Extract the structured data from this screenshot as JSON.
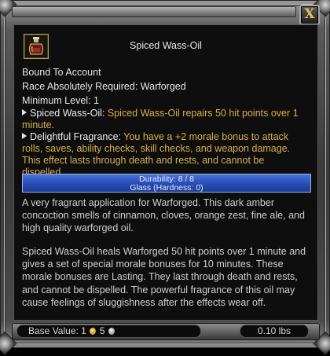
{
  "window": {
    "close_label": "X"
  },
  "item": {
    "icon": "oil-bottle-icon",
    "title": "Spiced Wass-Oil",
    "bound": "Bound To Account",
    "race_required": "Race Absolutely Required: Warforged",
    "min_level": "Minimum Level: 1"
  },
  "effects": [
    {
      "name": "Spiced Wass-Oil:",
      "text": "Spiced Wass-Oil repairs 50 hit points over 1 minute."
    },
    {
      "name": "Delightful Fragrance:",
      "text": "You have a +2 morale bonus to attack rolls, saves, ability checks, skill checks, and weapon damage. This effect lasts through death and rests, and cannot be dispelled."
    }
  ],
  "durability": {
    "label": "Durability: 8 / 8",
    "material": "Glass (Hardness: 0)",
    "fraction": 1.0
  },
  "description": [
    "A very fragrant application for Warforged. This dark amber concoction smells of cinnamon, cloves, orange zest, fine ale, and high quality warforged oil.",
    "Spiced Wass-Oil heals Warforged 50 hit points over 1 minute and gives a set of special morale bonuses for 10 minutes. These morale bonuses are Lasting. They last through death and rests, and cannot be dispelled. The powerful fragrance of this oil may cause feelings of sluggishness after the effects wear off."
  ],
  "footer": {
    "base_value_label": "Base Value:",
    "gold": "1",
    "silver": "5",
    "weight": "0.10 lbs"
  },
  "colors": {
    "effect_text": "#d6b14a",
    "durability_bar": "#2a4fb8"
  }
}
